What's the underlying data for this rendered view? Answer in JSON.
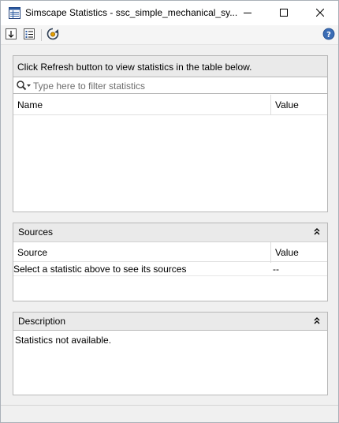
{
  "window": {
    "title": "Simscape Statistics - ssc_simple_mechanical_sy...",
    "icons": {
      "app": "table-window-icon",
      "minimize": "minimize-icon",
      "maximize": "maximize-icon",
      "close": "close-icon"
    }
  },
  "toolbar": {
    "icons": [
      "sort-icon",
      "list-view-icon",
      "refresh-icon",
      "help-icon"
    ]
  },
  "statistics": {
    "info_text": "Click Refresh button to view statistics in the table below.",
    "filter_placeholder": "Type here to filter statistics",
    "filter_value": "",
    "columns": {
      "name": "Name",
      "value": "Value"
    },
    "rows": []
  },
  "sources": {
    "title": "Sources",
    "columns": {
      "source": "Source",
      "value": "Value"
    },
    "rows": [
      {
        "source": "Select a statistic above to see its sources",
        "value": "--"
      }
    ]
  },
  "description": {
    "title": "Description",
    "text": "Statistics not available."
  },
  "colors": {
    "panel_header_bg": "#eaeaea",
    "window_bg": "#f0f0f0",
    "border": "#b8b8b8",
    "help_icon": "#3b6db5"
  }
}
